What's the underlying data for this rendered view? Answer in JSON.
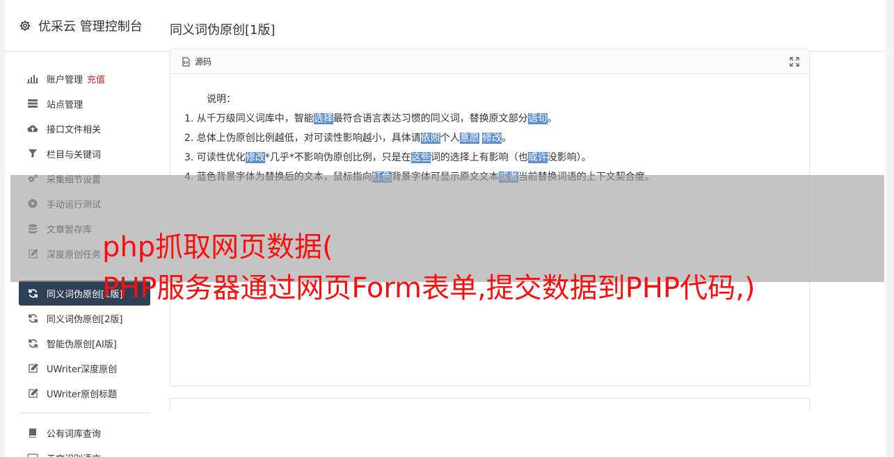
{
  "header": {
    "title": "优采云 管理控制台",
    "icon": "gear-icon"
  },
  "sidebar": {
    "group1": [
      {
        "label": "账户管理",
        "badge": "充值",
        "icon": "bar-chart-icon"
      },
      {
        "label": "站点管理",
        "icon": "server-icon"
      },
      {
        "label": "接口文件相关",
        "icon": "cloud-upload-icon"
      },
      {
        "label": "栏目与关键词",
        "icon": "filter-icon"
      },
      {
        "label": "采集细节设置",
        "icon": "cogs-icon"
      },
      {
        "label": "手动运行测试",
        "icon": "play-circle-icon"
      },
      {
        "label": "文章暂存库",
        "icon": "database-icon"
      },
      {
        "label": "深度原创任务",
        "icon": "edit-icon"
      }
    ],
    "group2": [
      {
        "label": "同义词伪原创[1版]",
        "icon": "refresh-icon",
        "active": true
      },
      {
        "label": "同义词伪原创[2版]",
        "icon": "refresh-icon"
      },
      {
        "label": "智能伪原创[AI版]",
        "icon": "refresh-icon"
      },
      {
        "label": "UWriter深度原创",
        "icon": "edit-icon"
      },
      {
        "label": "UWriter原创标题",
        "icon": "edit-icon"
      }
    ],
    "group3": [
      {
        "label": "公有词库查询",
        "icon": "book-icon"
      },
      {
        "label": "于文识别语言",
        "icon": "keyboard-icon"
      }
    ]
  },
  "main": {
    "page_title": "同义词伪原创[1版]",
    "card_title": "源码",
    "intro": "说明：",
    "lines": [
      [
        {
          "t": "1. 从千万级同义词库中，智能"
        },
        {
          "t": "选择",
          "h": true
        },
        {
          "t": "最符合语言表达习惯的同义词，替换原文部分"
        },
        {
          "t": "语句",
          "h": true
        },
        {
          "t": "。"
        }
      ],
      [
        {
          "t": "2. 总体上伪原创比例越低，对可读性影响越小，具体请"
        },
        {
          "t": "依照",
          "h": true
        },
        {
          "t": "个人"
        },
        {
          "t": "意愿",
          "h": true
        },
        {
          "t": " "
        },
        {
          "t": "修改",
          "h": true
        },
        {
          "t": "。"
        }
      ],
      [
        {
          "t": "3. 可读性优化"
        },
        {
          "t": "修改",
          "h": true
        },
        {
          "t": "*几乎*不影响伪原创比例，只是在"
        },
        {
          "t": "这些",
          "h": true
        },
        {
          "t": "词的选择上有影响（也"
        },
        {
          "t": "或许",
          "h": true
        },
        {
          "t": "没影响）。"
        }
      ],
      [
        {
          "t": "4. 蓝色背景字体为替换后的文本，鼠标指向"
        },
        {
          "t": "红色",
          "h": true
        },
        {
          "t": "背景字体可显示原文文本"
        },
        {
          "t": "或者",
          "h": true
        },
        {
          "t": "当前替换词语的上下文契合度。"
        }
      ]
    ]
  },
  "overlay": {
    "line1": "php抓取网页数据(",
    "line2": "PHP服务器通过网页Form表单,提交数据到PHP代码,)"
  },
  "colors": {
    "accent_active": "#2f4056",
    "highlight": "#5d8fd5",
    "overlay_text": "#ff0d0d",
    "recharge": "#e31e1e"
  }
}
